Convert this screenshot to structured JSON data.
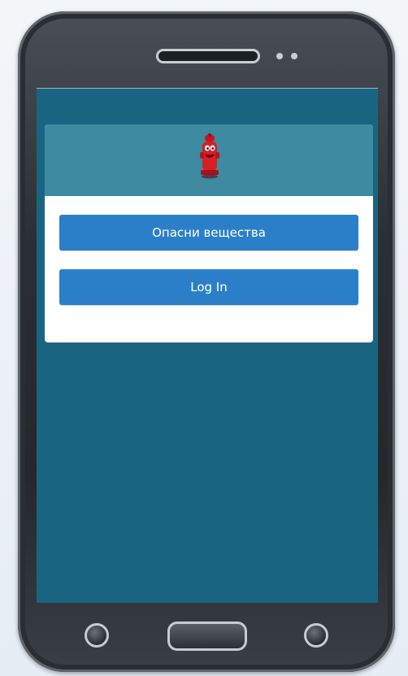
{
  "app": {
    "buttons": {
      "hazardous_substances": "Опасни вещества",
      "login": "Log In"
    },
    "colors": {
      "screen_background": "#196581",
      "header_background": "#3e8aa0",
      "button_background": "#2b7fc8",
      "card_background": "#ffffff"
    },
    "icons": {
      "logo": "fire-hydrant-mascot-icon"
    }
  }
}
